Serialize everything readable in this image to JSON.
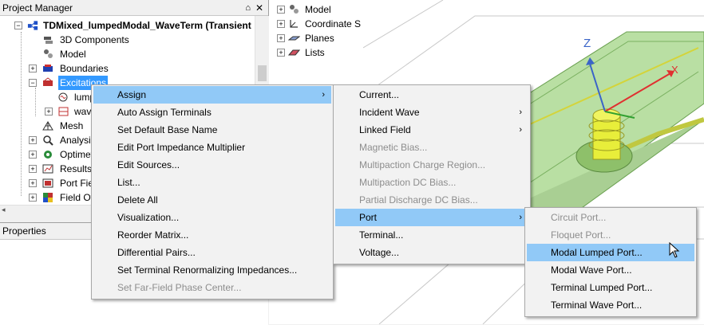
{
  "project_manager": {
    "title": "Project Manager",
    "pin_glyph": "⌂",
    "close_glyph": "✕",
    "tree": {
      "root": "TDMixed_lumpedModal_WaveTerm (Transient",
      "components": "3D Components",
      "model": "Model",
      "boundaries": "Boundaries",
      "excitations": "Excitations",
      "lumped": "lump",
      "wave": "wav",
      "mesh": "Mesh",
      "analysis": "Analysis",
      "optimetrics": "Optimet",
      "results": "Results",
      "port_field": "Port Fie",
      "field_overlays": "Field Ov"
    }
  },
  "properties": {
    "title": "Properties"
  },
  "model_tree": {
    "items": [
      "Model",
      "Coordinate S",
      "Planes",
      "Lists"
    ]
  },
  "view": {
    "axis_z": "Z",
    "axis_x": "X"
  },
  "context_menu": {
    "items": [
      {
        "label": "Assign",
        "has_submenu": true,
        "highlighted": true
      },
      {
        "label": "Auto Assign Terminals"
      },
      {
        "label": "Set Default Base Name"
      },
      {
        "label": "Edit Port Impedance Multiplier"
      },
      {
        "label": "Edit Sources..."
      },
      {
        "label": "List..."
      },
      {
        "label": "Delete All"
      },
      {
        "label": "Visualization..."
      },
      {
        "label": "Reorder Matrix..."
      },
      {
        "label": "Differential Pairs..."
      },
      {
        "label": "Set Terminal Renormalizing Impedances..."
      },
      {
        "label": "Set Far-Field Phase Center...",
        "disabled": true
      }
    ]
  },
  "assign_menu": {
    "items": [
      {
        "label": "Current..."
      },
      {
        "label": "Incident Wave",
        "has_submenu": true
      },
      {
        "label": "Linked Field",
        "has_submenu": true
      },
      {
        "label": "Magnetic Bias...",
        "disabled": true
      },
      {
        "label": "Multipaction Charge Region...",
        "disabled": true
      },
      {
        "label": "Multipaction DC Bias...",
        "disabled": true
      },
      {
        "label": "Partial Discharge DC Bias...",
        "disabled": true
      },
      {
        "label": "Port",
        "has_submenu": true,
        "highlighted": true
      },
      {
        "label": "Terminal..."
      },
      {
        "label": "Voltage..."
      }
    ]
  },
  "port_menu": {
    "items": [
      {
        "label": "Circuit Port...",
        "disabled": true
      },
      {
        "label": "Floquet Port...",
        "disabled": true
      },
      {
        "label": "Modal Lumped Port...",
        "highlighted": true
      },
      {
        "label": "Modal Wave Port..."
      },
      {
        "label": "Terminal Lumped Port..."
      },
      {
        "label": "Terminal Wave Port..."
      }
    ]
  },
  "submenu_arrow": "›",
  "colors": {
    "menu_highlight": "#91c9f7",
    "tree_selection": "#3399ff",
    "substrate_green": "#b9dfa3",
    "conductor_yellow": "#e8ee3a",
    "axis_z": "#3a64c8",
    "axis_x": "#e03030"
  }
}
